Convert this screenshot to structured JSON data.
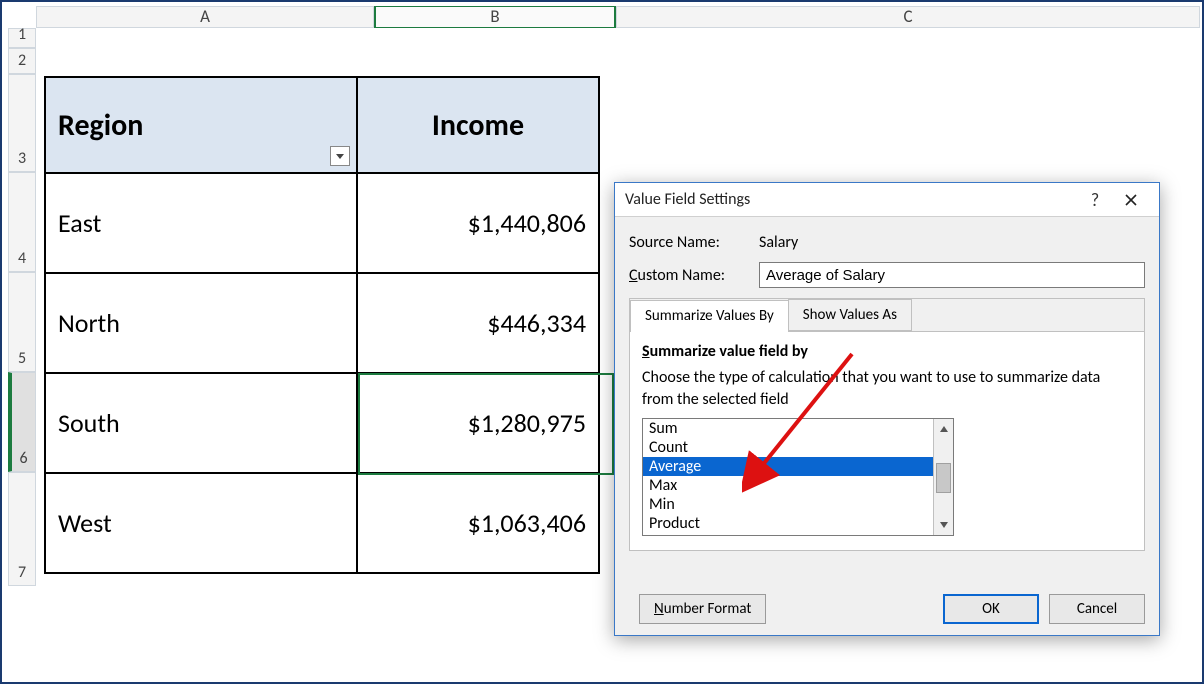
{
  "columns": {
    "A": "A",
    "B": "B",
    "C": "C"
  },
  "rows": {
    "r1": "1",
    "r2": "2",
    "r3": "3",
    "r4": "4",
    "r5": "5",
    "r6": "6",
    "r7": "7"
  },
  "table": {
    "headers": {
      "region": "Region",
      "income": "Income"
    },
    "rows": [
      {
        "region": "East",
        "income": "$1,440,806"
      },
      {
        "region": "North",
        "income": "$446,334"
      },
      {
        "region": "South",
        "income": "$1,280,975"
      },
      {
        "region": "West",
        "income": "$1,063,406"
      }
    ]
  },
  "dialog": {
    "title": "Value Field Settings",
    "source_name_label": "Source Name:",
    "source_name_value": "Salary",
    "custom_name_label_pre": "C",
    "custom_name_label_post": "ustom Name:",
    "custom_name_value": "Average of Salary",
    "tabs": {
      "summarize": "Summarize Values By",
      "showas": "Show Values As"
    },
    "section_head_pre": "S",
    "section_head_post": "ummarize value field by",
    "section_desc": "Choose the type of calculation that you want to use to summarize data from the selected field",
    "list": [
      "Sum",
      "Count",
      "Average",
      "Max",
      "Min",
      "Product"
    ],
    "selected_index": 2,
    "buttons": {
      "number_format_pre": "N",
      "number_format_post": "umber Format",
      "ok": "OK",
      "cancel": "Cancel"
    }
  }
}
